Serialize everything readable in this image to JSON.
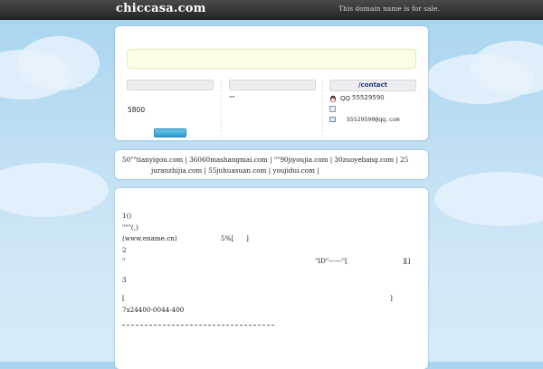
{
  "topbar": {
    "domain": "chiccasa.com",
    "forsale": "This domain name is for sale."
  },
  "offer": {
    "field_text": "\"\"",
    "price": "5800"
  },
  "contact": {
    "header": "/contact",
    "qq_label": "QQ",
    "qq_number": "55529590",
    "email": "55529590@qq.com"
  },
  "links": {
    "line1": "50\"\"tianyigou.com | 36060mashangmai.com | \"\"90jiyoujia.com | 30zuoyebang.com | 25",
    "line2": "juranzhijia.com | 55juhuasuan.com | youjidui.com  |"
  },
  "article": {
    "l1": "1()",
    "l2": "\"\"\"(,)",
    "l3_a": "(www.ename.cn)",
    "l3_b": "5%[",
    "l3_c": "]",
    "l4": "2",
    "l5_a": "\"",
    "l5_b": "\"ID\"------\"[",
    "l5_c": "][]",
    "l6": "3",
    "l7_a": "[",
    "l7_b": "]",
    "l8": "7x24400-0044-400"
  },
  "colors": {
    "topbar": "#262626",
    "contact_header": "#243a78",
    "button": "#2a9bd0",
    "notice_bg": "#fdfde6"
  }
}
